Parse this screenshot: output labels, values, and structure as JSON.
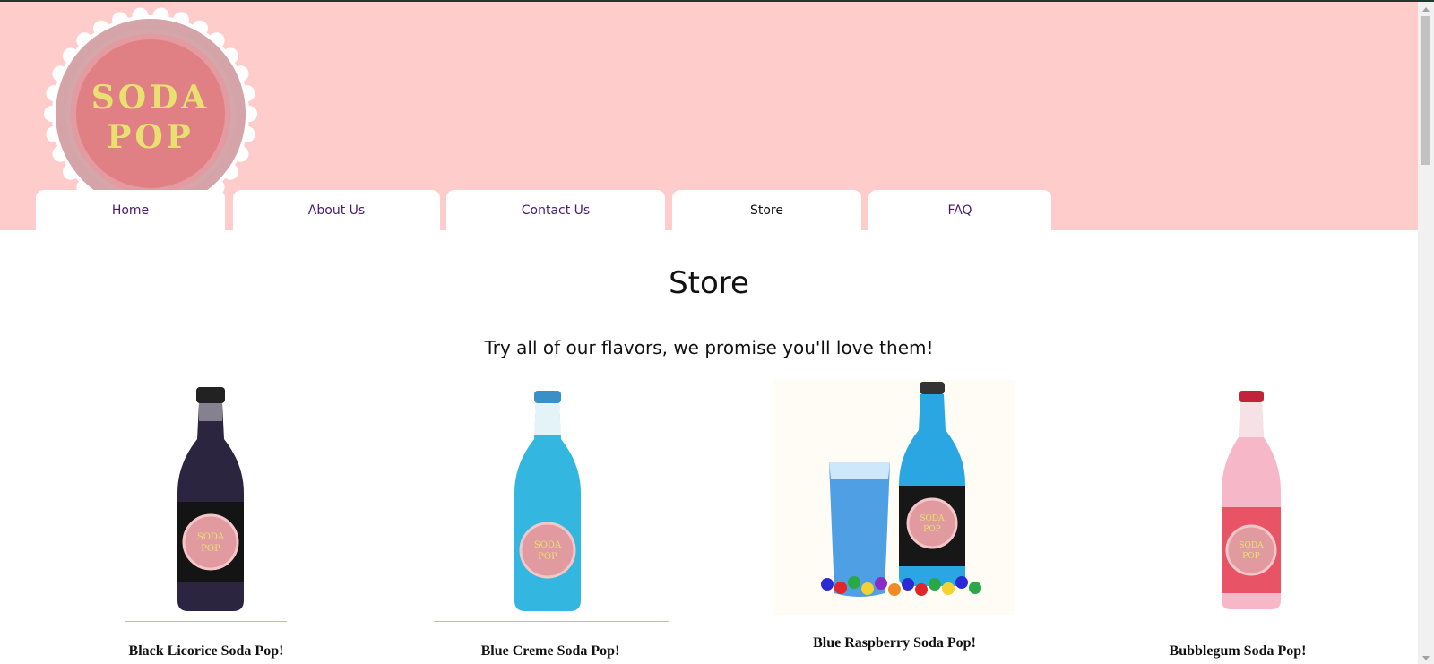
{
  "header": {
    "logo_line1": "SODA",
    "logo_line2": "POP",
    "background": "#ffcccc"
  },
  "nav": {
    "tabs": [
      {
        "label": "Home",
        "active": false
      },
      {
        "label": "About Us",
        "active": false
      },
      {
        "label": "Contact Us",
        "active": false
      },
      {
        "label": "Store",
        "active": true
      },
      {
        "label": "FAQ",
        "active": false
      }
    ]
  },
  "main": {
    "title": "Store",
    "subtitle": "Try all of our flavors, we promise you'll love them!"
  },
  "products": [
    {
      "name": "Black Licorice Soda Pop!",
      "image": "black-licorice-bottle",
      "liquid_color": "#2b1f4a",
      "label_color": "#1a1a1a"
    },
    {
      "name": "Blue Creme Soda Pop!",
      "image": "blue-creme-bottle",
      "liquid_color": "#33b6e0",
      "label_color": "#33b6e0"
    },
    {
      "name": "Blue Raspberry Soda Pop!",
      "image": "blue-raspberry-bottle-with-glass-and-gumballs",
      "liquid_color": "#2aa7e3",
      "label_color": "#1a1a1a"
    },
    {
      "name": "Bubblegum Soda Pop!",
      "image": "bubblegum-bottle",
      "liquid_color": "#f6b8c8",
      "label_color": "#e85466"
    }
  ],
  "label_seal": {
    "line1": "SODA",
    "line2": "POP"
  }
}
